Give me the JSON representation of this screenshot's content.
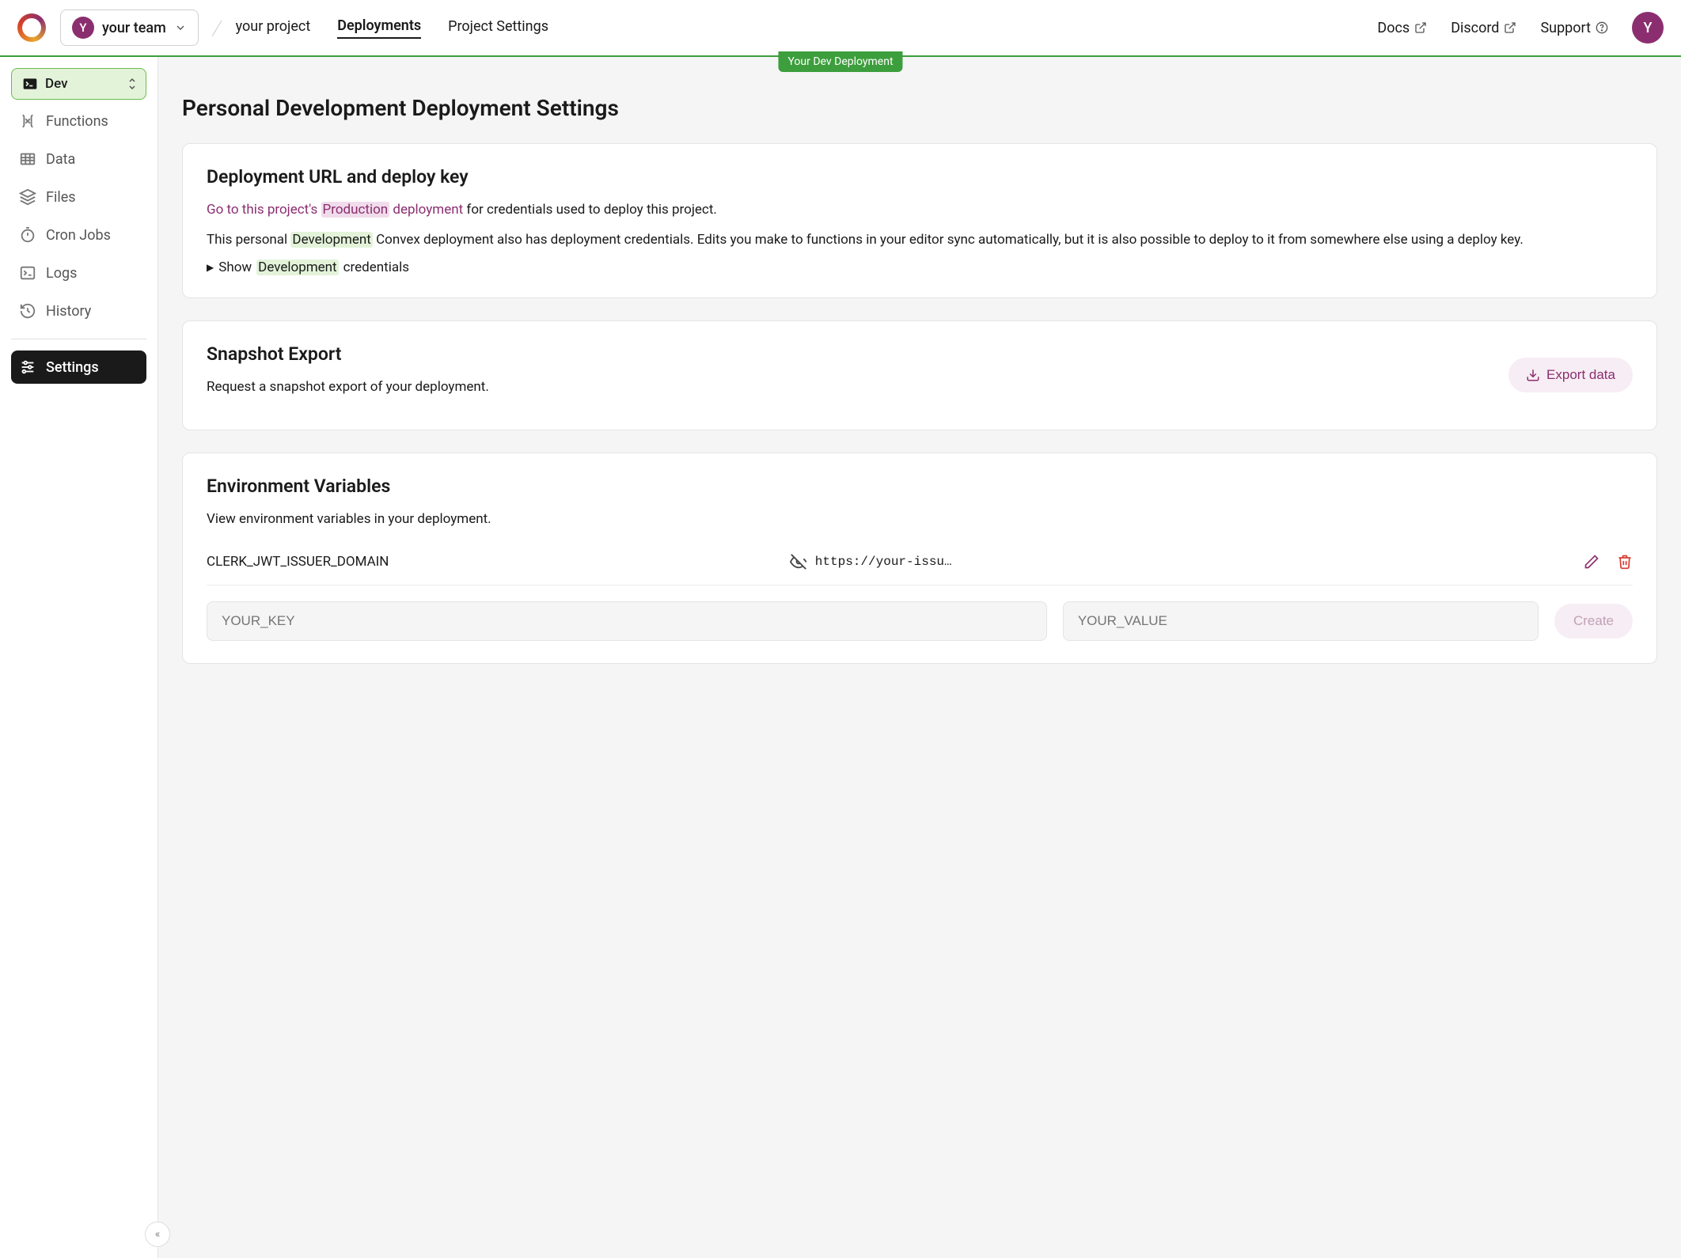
{
  "header": {
    "team_avatar_letter": "Y",
    "team_name": "your team",
    "project_name": "your project",
    "tabs": {
      "deployments": "Deployments",
      "project_settings": "Project Settings"
    },
    "links": {
      "docs": "Docs",
      "discord": "Discord",
      "support": "Support"
    },
    "user_avatar_letter": "Y",
    "dev_tag": "Your Dev Deployment"
  },
  "sidebar": {
    "env_label": "Dev",
    "items": {
      "functions": "Functions",
      "data": "Data",
      "files": "Files",
      "cron": "Cron Jobs",
      "logs": "Logs",
      "history": "History",
      "settings": "Settings"
    }
  },
  "page": {
    "title": "Personal Development Deployment Settings"
  },
  "card_url": {
    "title": "Deployment URL and deploy key",
    "link_pre": "Go to this project's ",
    "link_prod": "Production",
    "link_post": " deployment",
    "link_tail": " for credentials used to deploy this project.",
    "para2_pre": "This personal ",
    "para2_dev": "Development",
    "para2_post": " Convex deployment also has deployment credentials. Edits you make to functions in your editor sync automatically, but it is also possible to deploy to it from somewhere else using a deploy key.",
    "show_pre": "Show ",
    "show_dev": "Development",
    "show_post": " credentials"
  },
  "card_snapshot": {
    "title": "Snapshot Export",
    "desc": "Request a snapshot export of your deployment.",
    "button": "Export data"
  },
  "card_env": {
    "title": "Environment Variables",
    "desc": "View environment variables in your deployment.",
    "vars": [
      {
        "key": "CLERK_JWT_ISSUER_DOMAIN",
        "value": "https://your-issu…"
      }
    ],
    "key_placeholder": "YOUR_KEY",
    "value_placeholder": "YOUR_VALUE",
    "create": "Create"
  }
}
